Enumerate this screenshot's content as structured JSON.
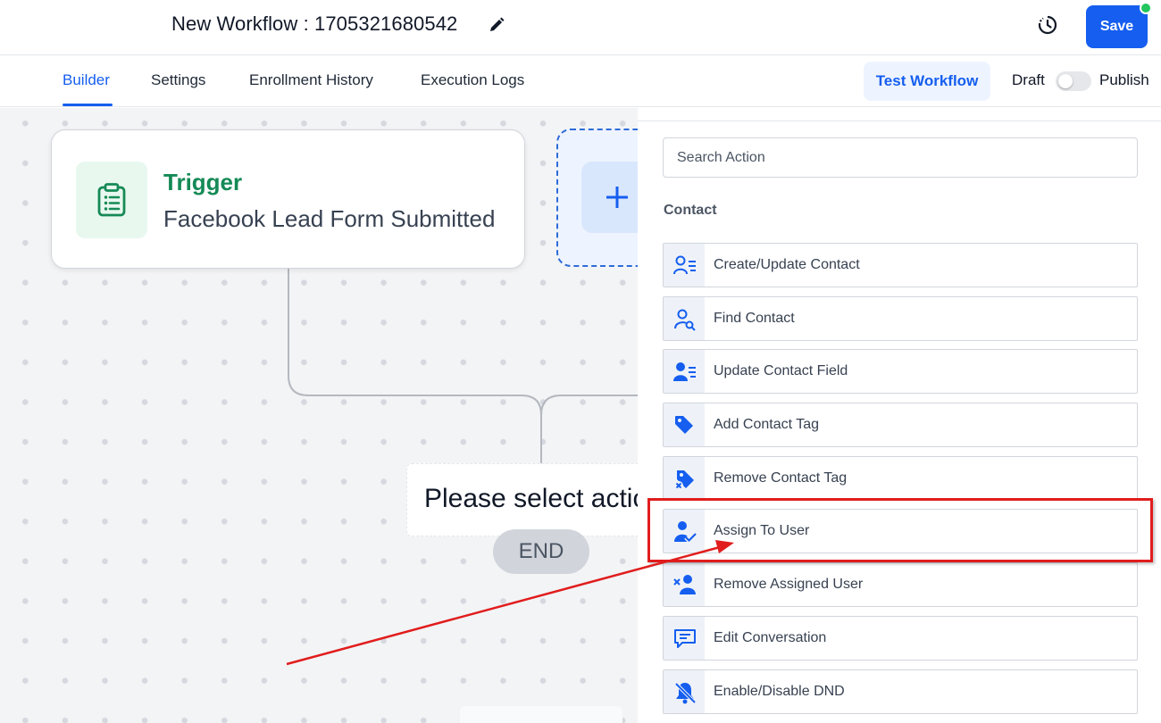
{
  "header": {
    "title": "New Workflow : 1705321680542",
    "save_label": "Save"
  },
  "tabs": [
    {
      "label": "Builder",
      "active": true
    },
    {
      "label": "Settings",
      "active": false
    },
    {
      "label": "Enrollment History",
      "active": false
    },
    {
      "label": "Execution Logs",
      "active": false
    }
  ],
  "toolbar": {
    "test_label": "Test Workflow",
    "draft_label": "Draft",
    "publish_label": "Publish",
    "published": false
  },
  "canvas": {
    "trigger_title": "Trigger",
    "trigger_subtitle": "Facebook Lead Form Submitted",
    "select_action_text": "Please select actic",
    "end_label": "END"
  },
  "panel": {
    "search_placeholder": "Search Action",
    "section_title": "Contact",
    "actions": [
      {
        "label": "Create/Update Contact",
        "icon": "contact-list-icon"
      },
      {
        "label": "Find Contact",
        "icon": "find-contact-icon"
      },
      {
        "label": "Update Contact Field",
        "icon": "contact-field-icon"
      },
      {
        "label": "Add Contact Tag",
        "icon": "tag-icon"
      },
      {
        "label": "Remove Contact Tag",
        "icon": "tag-remove-icon"
      },
      {
        "label": "Assign To User",
        "icon": "user-check-icon"
      },
      {
        "label": "Remove Assigned User",
        "icon": "user-remove-icon"
      },
      {
        "label": "Edit Conversation",
        "icon": "chat-icon"
      },
      {
        "label": "Enable/Disable DND",
        "icon": "bell-off-icon"
      }
    ]
  },
  "colors": {
    "primary": "#155eef",
    "trigger_green": "#158a56",
    "annotation_red": "#e11d1d",
    "status_dot": "#22c55e"
  }
}
